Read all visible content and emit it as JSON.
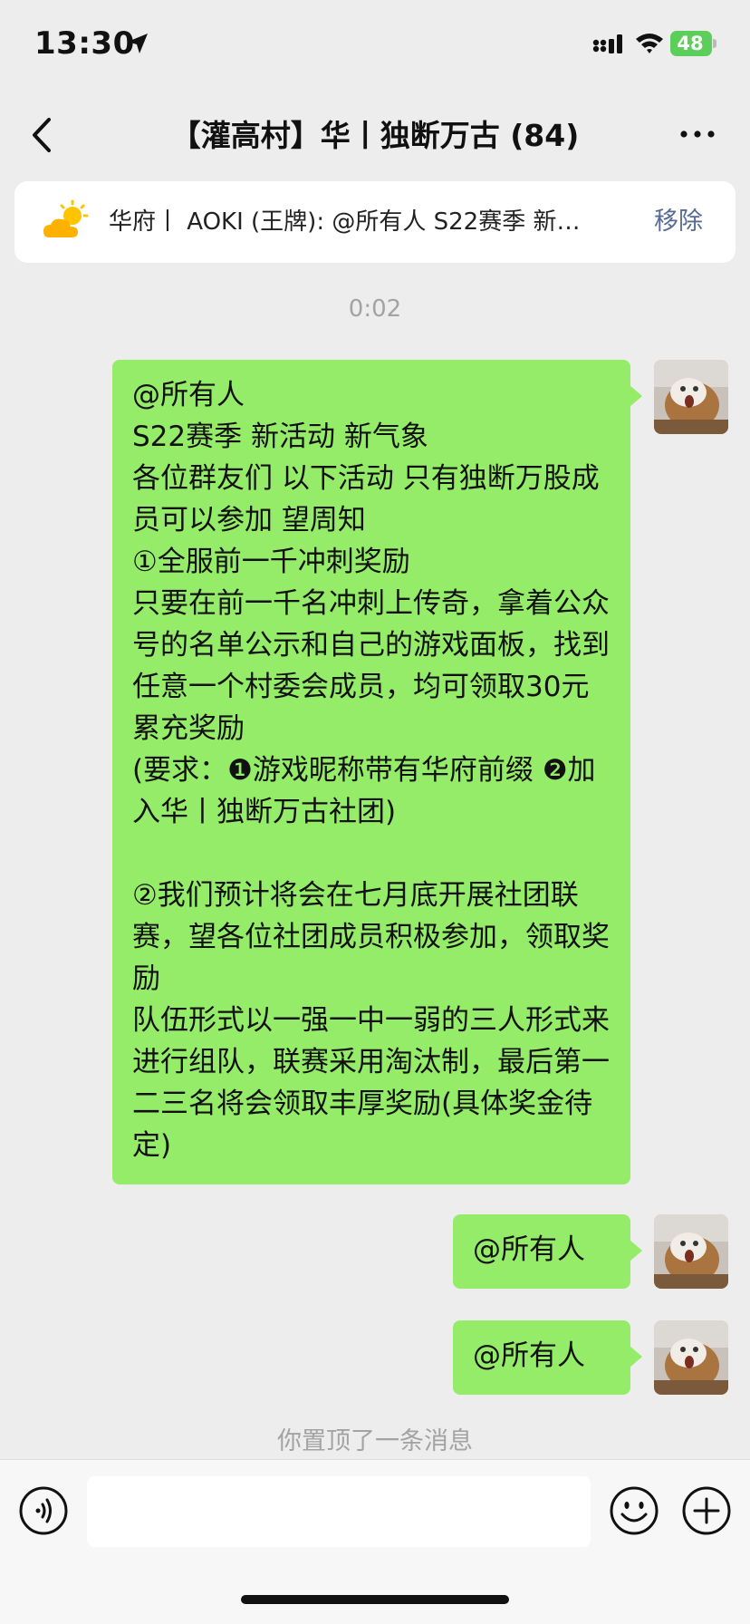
{
  "status_bar": {
    "time": "13:30",
    "battery": "48"
  },
  "header": {
    "title": "【灌高村】华丨独断万古 (84)"
  },
  "pinned": {
    "text": "华府丨 AOKI (王牌): @所有人  S22赛季 新…",
    "remove_label": "移除"
  },
  "chat": {
    "timestamp": "0:02",
    "messages": [
      {
        "text": "@所有人\nS22赛季 新活动 新气象\n各位群友们 以下活动 只有独断万股成员可以参加 望周知\n①全服前一千冲刺奖励\n只要在前一千名冲刺上传奇，拿着公众号的名单公示和自己的游戏面板，找到任意一个村委会成员，均可领取30元累充奖励\n(要求：❶游戏昵称带有华府前缀 ❷加入华丨独断万古社团)\n\n②我们预计将会在七月底开展社团联赛，望各位社团成员积极参加，领取奖励\n队伍形式以一强一中一弱的三人形式来进行组队，联赛采用淘汰制，最后第一二三名将会领取丰厚奖励(具体奖金待定)"
      },
      {
        "text": "@所有人"
      },
      {
        "text": "@所有人"
      }
    ],
    "system_note": "你置顶了一条消息"
  },
  "input_bar": {
    "placeholder": ""
  },
  "colors": {
    "bubble": "#95ec69",
    "background": "#ededed",
    "link": "#576b95",
    "battery": "#5ccf5a"
  },
  "icons": [
    "location-arrow-icon",
    "signal-icon",
    "wifi-icon",
    "battery-icon",
    "back-chevron-icon",
    "more-dots-icon",
    "sun-cloud-icon",
    "avatar",
    "voice-icon",
    "emoji-icon",
    "plus-icon"
  ]
}
